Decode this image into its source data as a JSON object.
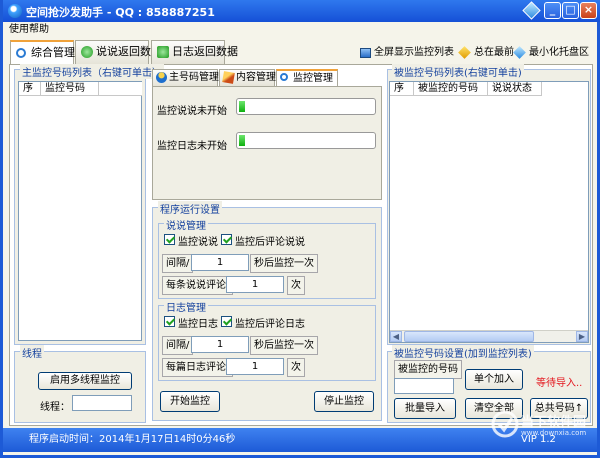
{
  "window": {
    "title": "空间抢沙发助手 - QQ : 858887251"
  },
  "menu": {
    "help": "使用帮助"
  },
  "tabs": [
    {
      "label": "综合管理",
      "active": true
    },
    {
      "label": "说说返回数据",
      "active": false
    },
    {
      "label": "日志返回数据",
      "active": false
    }
  ],
  "toolbar": {
    "fullscreen": "全屏显示监控列表",
    "always_top": "总在最前",
    "minimize_tray": "最小化托盘区"
  },
  "left": {
    "list_title": "主监控号码列表（右键可单击）",
    "columns": [
      "序",
      "监控号码"
    ],
    "thread_title": "线程",
    "enable_button": "启用多线程监控",
    "thread_label": "线程：",
    "thread_value": ""
  },
  "middle": {
    "inner_tabs": [
      "主号码管理",
      "内容管理",
      "监控管理"
    ],
    "status_shuoshuo": "监控说说未开始",
    "status_rizhi": "监控日志未开始",
    "progress_shuoshuo": 0.02,
    "progress_rizhi": 0.02,
    "settings_title": "程序运行设置",
    "shuoshuo": {
      "title": "说说管理",
      "cb_monitor": "监控说说",
      "cb_comment": "监控后评论说说",
      "interval_label": "间隔/",
      "interval_value": "1",
      "interval_suffix": "秒后监控一次",
      "per_label": "每条说说评论/",
      "per_value": "1",
      "per_suffix": "次"
    },
    "rizhi": {
      "title": "日志管理",
      "cb_monitor": "监控日志",
      "cb_comment": "监控后评论日志",
      "interval_label": "间隔/",
      "interval_value": "1",
      "interval_suffix": "秒后监控一次",
      "per_label": "每篇日志评论/",
      "per_value": "1",
      "per_suffix": "次"
    },
    "start_button": "开始监控",
    "stop_button": "停止监控"
  },
  "right": {
    "list_title": "被监控号码列表(右键可单击)",
    "columns": [
      "序",
      "被监控的号码",
      "说说状态"
    ],
    "settings_title": "被监控号码设置(加到监控列表)",
    "number_label": "被监控的号码",
    "add_button": "单个加入",
    "waiting": "等待导入..",
    "batch_button": "批量导入",
    "clear_button": "清空全部",
    "total_button": "总共号码↑"
  },
  "status": {
    "runtime": "程序启动时间：2014年1月17日14时0分46秒",
    "vip": "VIP 1.2"
  },
  "watermark": {
    "text": "当下软件园",
    "url": "www.downxia.com"
  }
}
